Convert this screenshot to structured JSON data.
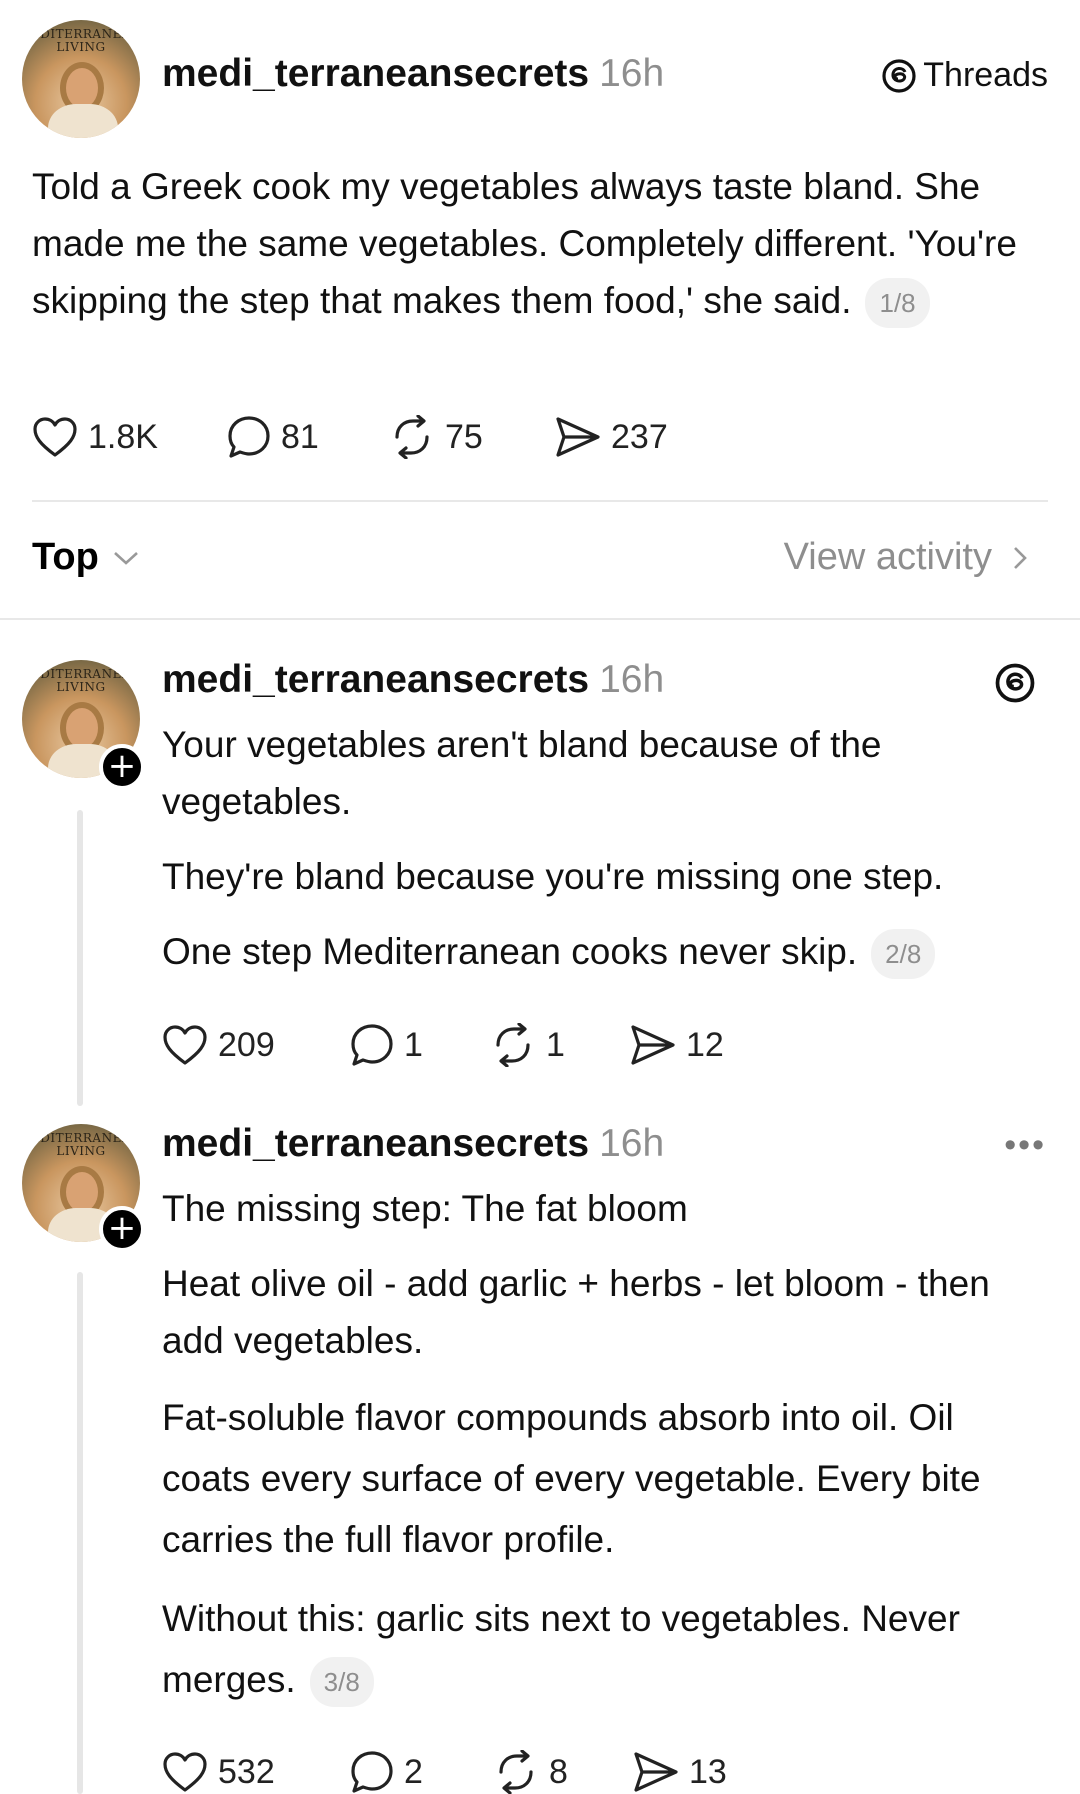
{
  "main_post": {
    "avatar_logo": "EDITERRANEA\nLIVING",
    "username": "medi_terraneansecrets",
    "time": "16h",
    "threads_label": "Threads",
    "text": "Told a Greek cook my vegetables always taste bland. She made me the same vegetables. Completely different. 'You're skipping the step that makes them food,' she said.",
    "pager": "1/8",
    "likes": "1.8K",
    "comments": "81",
    "reposts": "75",
    "shares": "237"
  },
  "sort_bar": {
    "sort_label": "Top",
    "view_activity": "View activity"
  },
  "reply1": {
    "username": "medi_terraneansecrets",
    "time": "16h",
    "paragraphs": [
      "Your vegetables aren't bland because of the vegetables.",
      "They're bland because you're missing one step.",
      "One step Mediterranean cooks never skip."
    ],
    "pager": "2/8",
    "likes": "209",
    "comments": "1",
    "reposts": "1",
    "shares": "12"
  },
  "reply2": {
    "username": "medi_terraneansecrets",
    "time": "16h",
    "paragraphs": [
      "The missing step: The fat bloom",
      "Heat olive oil - add garlic + herbs - let bloom - then add vegetables.",
      "Fat-soluble flavor compounds absorb into oil. Oil coats every surface of every vegetable. Every bite carries the full flavor profile.",
      "Without this: garlic sits next to vegetables. Never merges."
    ],
    "pager": "3/8",
    "likes": "532",
    "comments": "2",
    "reposts": "8",
    "shares": "13"
  }
}
